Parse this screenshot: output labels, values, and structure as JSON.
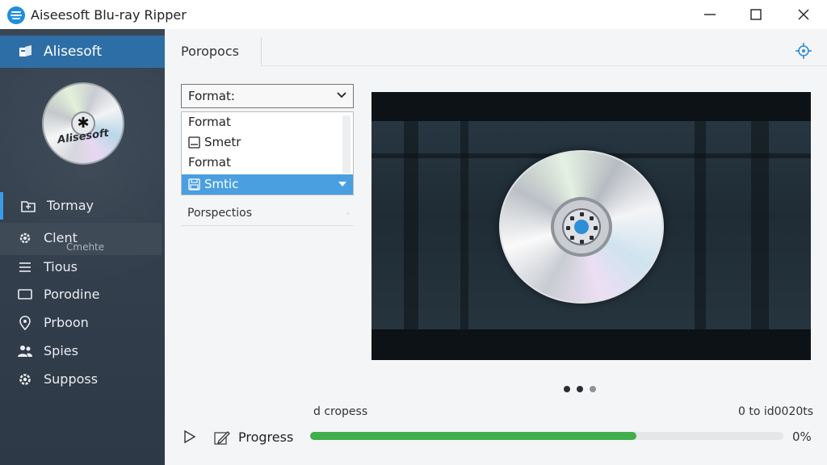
{
  "window": {
    "title": "Aiseesoft Blu-ray Ripper",
    "app_icon": "aiseesoft-logo-icon",
    "controls": [
      "minimize-icon",
      "maximize-icon",
      "close-icon"
    ]
  },
  "sidebar": {
    "brand": {
      "label": "Alisesoft",
      "icon": "brand-icon"
    },
    "disc_label": "Alisesoft",
    "items": [
      {
        "label": "Tormay",
        "icon": "folder-icon",
        "active": true
      },
      {
        "label": "Clent",
        "sublabel": "Cmehte",
        "icon": "gear-icon",
        "hover": true
      },
      {
        "label": "Tious",
        "icon": "list-icon"
      },
      {
        "label": "Porodine",
        "icon": "screen-icon"
      },
      {
        "label": "Prboon",
        "icon": "location-icon"
      },
      {
        "label": "Spies",
        "icon": "users-icon"
      },
      {
        "label": "Supposs",
        "icon": "cog-icon"
      }
    ],
    "accent_color": "#3b9be8",
    "brand_color": "#2e6ea6"
  },
  "main": {
    "tab_label": "Poropocs",
    "settings_icon": "crosshair-gear-icon",
    "format_select": {
      "value": "Format:",
      "options": [
        {
          "label": "Format",
          "icon": ""
        },
        {
          "label": "Smetr",
          "icon": "minus-box-icon"
        },
        {
          "label": "Format",
          "icon": ""
        },
        {
          "label": "Smtic",
          "icon": "save-icon",
          "selected": true
        }
      ]
    },
    "perspective_label": "Porspectios",
    "status": {
      "left": "d cropess",
      "right": "0 to id0020ts"
    },
    "progress": {
      "label": "Progress",
      "fraction": 0.69,
      "percent_text": "0%",
      "fill_color": "#3fae4b"
    }
  }
}
